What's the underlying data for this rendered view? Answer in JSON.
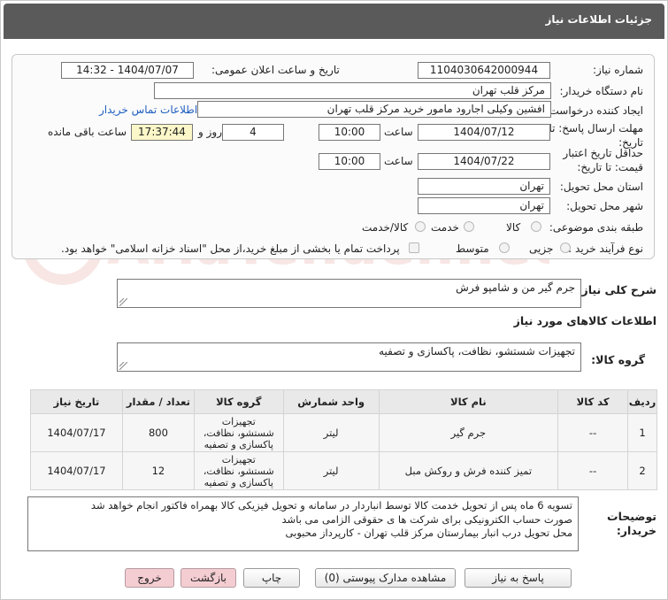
{
  "header": {
    "title": "جزئیات اطلاعات نیاز"
  },
  "form": {
    "need_number_label": "شماره نیاز:",
    "need_number": "1104030642000944",
    "announce_label": "تاریخ و ساعت اعلان عمومی:",
    "announce_value": "1404/07/07 - 14:32",
    "buyer_org_label": "نام دستگاه خریدار:",
    "buyer_org": "مرکز قلب تهران",
    "requester_label": "ایجاد کننده درخواست:",
    "requester": "افشین وکیلی اجارود مامور خرید مرکز قلب تهران",
    "contact_link": "اطلاعات تماس خریدار",
    "deadline_label_1": "مهلت ارسال پاسخ: تا",
    "deadline_label_2": "تاریخ:",
    "deadline_date": "1404/07/12",
    "time_label": "ساعت",
    "deadline_time": "10:00",
    "days_value": "4",
    "days_label": "روز و",
    "remaining_time": "17:37:44",
    "remaining_label": "ساعت باقی مانده",
    "validity_label_1": "حداقل تاریخ اعتبار",
    "validity_label_2": "قیمت: تا تاریخ:",
    "validity_date": "1404/07/22",
    "validity_time_label": "ساعت",
    "validity_time": "10:00",
    "province_label": "استان محل تحویل:",
    "province": "تهران",
    "city_label": "شهر محل تحویل:",
    "city": "تهران",
    "category_label": "طبقه بندی موضوعی:",
    "category_options": [
      "کالا",
      "خدمت",
      "کالا/خدمت"
    ],
    "process_label": "نوع فرآیند خرید :",
    "process_options": [
      "جزیی",
      "متوسط"
    ],
    "payment_note": "پرداخت تمام یا بخشی از مبلغ خرید،از محل \"اسناد خزانه اسلامی\" خواهد بود."
  },
  "summary": {
    "label": "شرح کلی نیاز:",
    "value": "جرم گیر من  و شامپو فرش"
  },
  "goods_section_title": "اطلاعات کالاهای مورد نیاز",
  "goods_group": {
    "label": "گروه کالا:",
    "value": "تجهیزات شستشو، نظافت، پاکسازی و تصفیه"
  },
  "table": {
    "headers": [
      "ردیف",
      "کد کالا",
      "نام کالا",
      "واحد شمارش",
      "گروه کالا",
      "تعداد / مقدار",
      "تاریخ نیاز"
    ],
    "rows": [
      {
        "index": "1",
        "code": "--",
        "name": "جرم گیر",
        "unit": "لیتر",
        "group_lines": [
          "تجهیزات",
          "شستشو، نظافت،",
          "پاکسازی و تصفیه"
        ],
        "qty": "800",
        "date": "1404/07/17"
      },
      {
        "index": "2",
        "code": "--",
        "name": "تمیز کننده فرش و روکش مبل",
        "unit": "لیتر",
        "group_lines": [
          "تجهیزات",
          "شستشو، نظافت،",
          "پاکسازی و تصفیه"
        ],
        "qty": "12",
        "date": "1404/07/17"
      }
    ]
  },
  "notes": {
    "label_1": "توضیحات",
    "label_2": "خریدار:",
    "lines": [
      "تسویه 6 ماه پس از تحویل خدمت کالا توسط انباردار در سامانه و تحویل فیزیکی کالا بهمراه فاکتور انجام خواهد شد",
      "صورت حساب الکترونیکی برای شرکت ها ی حقوقی الزامی می باشد",
      "محل تحویل درب انبار بیمارستان مرکز قلب تهران - کارپرداز محبوبی"
    ]
  },
  "buttons": {
    "reply": "پاسخ به نیاز",
    "attachments": "مشاهده مدارک پیوستی (0)",
    "print": "چاپ",
    "back": "بازگشت",
    "exit": "خروج"
  },
  "watermark": "AriaTender.net",
  "colors": {
    "header_bg": "#5a5a5a",
    "link": "#1e5fbf",
    "timer_bg": "#fbf7c8",
    "pink_button": "#f4cdd2"
  }
}
